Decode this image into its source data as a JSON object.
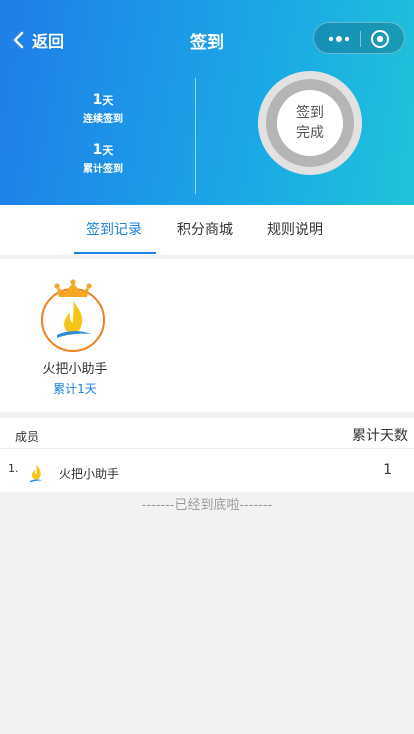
{
  "nav": {
    "back_label": "返回",
    "title": "签到"
  },
  "stats": {
    "consecutive": {
      "value": "1",
      "unit": "天",
      "label": "连续签到"
    },
    "total": {
      "value": "1",
      "unit": "天",
      "label": "累计签到"
    }
  },
  "sign_button": {
    "line1": "签到",
    "line2": "完成"
  },
  "tabs": [
    {
      "label": "签到记录",
      "active": true
    },
    {
      "label": "积分商城",
      "active": false
    },
    {
      "label": "规则说明",
      "active": false
    }
  ],
  "featured_member": {
    "name": "火把小助手",
    "days_text": "累计1天"
  },
  "list": {
    "header_left": "成员",
    "header_right": "累计天数",
    "rows": [
      {
        "rank": "1.",
        "name": "火把小助手",
        "count": "1"
      }
    ]
  },
  "footer_tip": "-------已经到底啦-------",
  "colors": {
    "accent": "#1a82e0",
    "crown": "#f5a623",
    "flame": "#f5c518"
  }
}
